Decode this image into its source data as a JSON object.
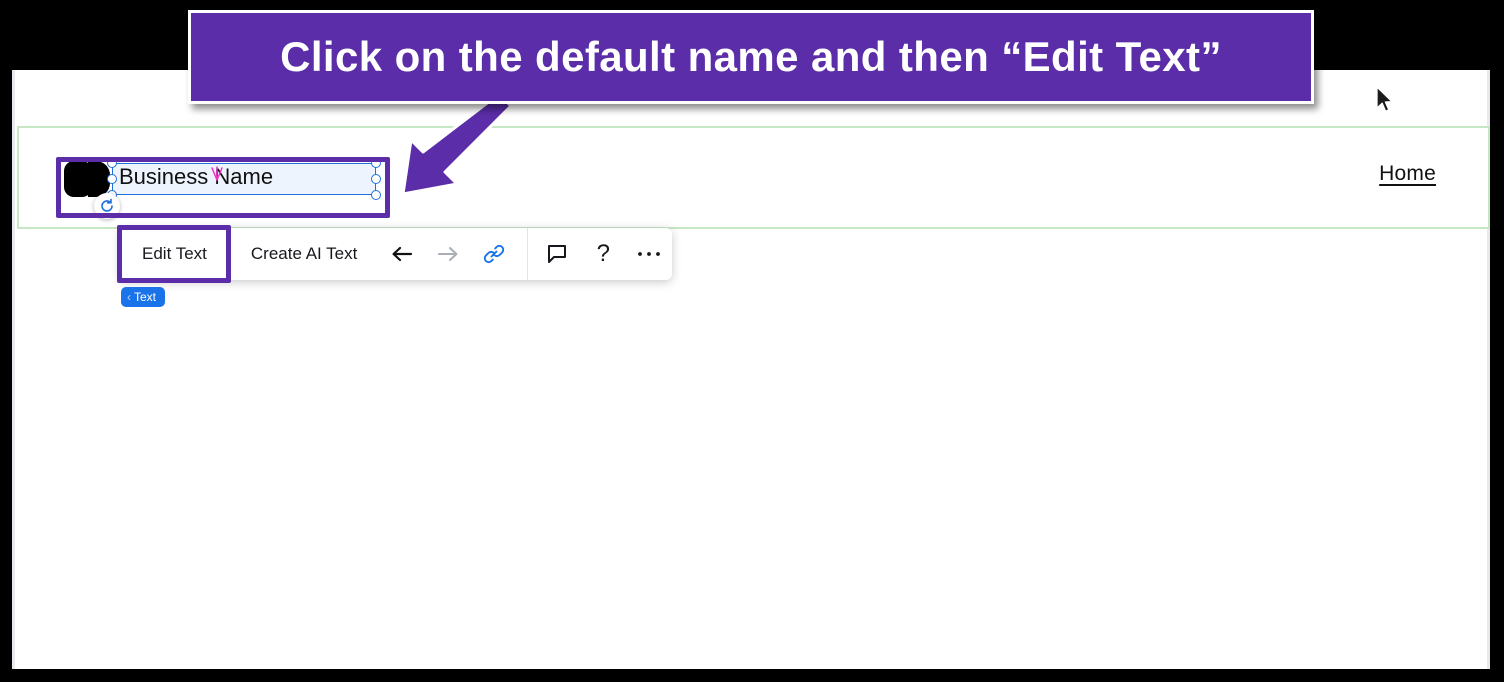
{
  "annotation": {
    "banner_text": "Click on the default name and then “Edit Text”",
    "banner_color": "#5b2da8",
    "highlight_color": "#5b2da8",
    "arrow_icon": "arrow-down-left-block-icon"
  },
  "site": {
    "header": {
      "section_outline_color": "#c6e7c4",
      "logo_placeholder_name": "logo-placeholder",
      "business_name": "Business Name",
      "nav": [
        {
          "label": "Home"
        }
      ]
    }
  },
  "selection": {
    "selected_element_label": "Business Name",
    "handle_color": "#1f6fe0",
    "rotate_icon": "rotate-icon",
    "caret_icon": "text-caret-icon",
    "badge": {
      "chevron": "‹",
      "label": "Text",
      "color": "#1a73e8"
    }
  },
  "toolbar": {
    "edit_text_label": "Edit Text",
    "create_ai_text_label": "Create AI Text",
    "items": [
      {
        "name": "back-arrow-icon",
        "state": "enabled"
      },
      {
        "name": "forward-arrow-icon",
        "state": "disabled"
      },
      {
        "name": "link-icon",
        "state": "active"
      },
      {
        "name": "comment-icon",
        "state": "enabled"
      },
      {
        "name": "help-icon",
        "label": "?",
        "state": "enabled"
      },
      {
        "name": "more-options-icon",
        "label": "•••",
        "state": "enabled"
      }
    ]
  },
  "cursor": {
    "name": "mouse-pointer-icon"
  }
}
